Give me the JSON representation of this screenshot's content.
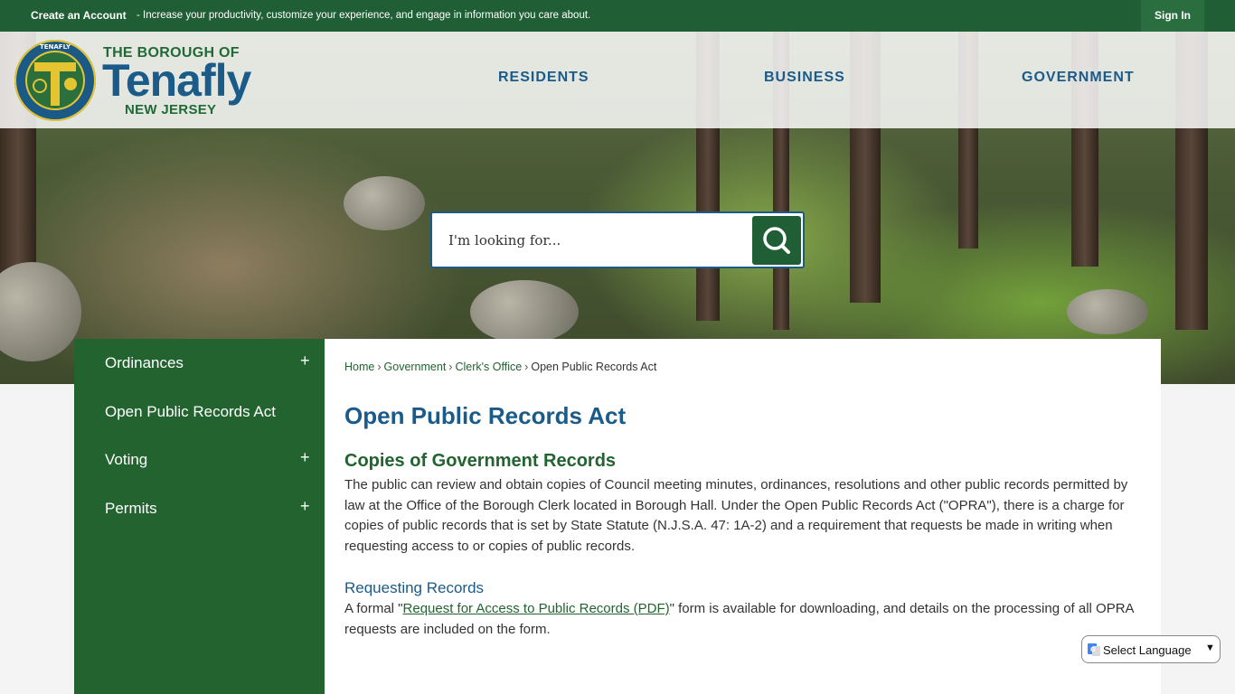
{
  "topbar": {
    "create_account": "Create an Account",
    "tagline": "- Increase your productivity, customize your experience, and engage in information you care about.",
    "sign_in": "Sign In"
  },
  "brand": {
    "line1": "THE BOROUGH OF",
    "line2": "Tenafly",
    "line3": "NEW JERSEY",
    "seal_text": "BOROUGH OF TENAFLY"
  },
  "nav": [
    "RESIDENTS",
    "BUSINESS",
    "GOVERNMENT"
  ],
  "search": {
    "placeholder": "I'm looking for..."
  },
  "sidebar": {
    "items": [
      {
        "label": "Ordinances",
        "expand": "+"
      },
      {
        "label": "Open Public Records Act",
        "expand": ""
      },
      {
        "label": "Voting",
        "expand": "+"
      },
      {
        "label": "Permits",
        "expand": "+"
      }
    ]
  },
  "breadcrumb": {
    "items": [
      "Home",
      "Government",
      "Clerk's Office",
      "Open Public Records Act"
    ],
    "separator": "›"
  },
  "page": {
    "title": "Open Public Records Act",
    "section1_heading": "Copies of Government Records",
    "section1_text": "The public can review and obtain copies of Council meeting minutes, ordinances, resolutions and other public records permitted by law at the Office of the Borough Clerk located in Borough Hall. Under the Open Public Records Act (\"OPRA\"), there is a charge for copies of public records that is set by State Statute (N.J.S.A. 47: 1A-2) and a requirement that requests be made in writing when requesting access to or copies of public records.",
    "section2_heading": "Requesting Records",
    "section2_before": "A formal \"",
    "section2_link": "Request for Access to Public Records (PDF)",
    "section2_after": "\" form is available for downloading, and details on the processing of all OPRA requests are included on the form."
  },
  "language": {
    "label": "Select Language"
  },
  "colors": {
    "green": "#22632f",
    "blue": "#1a5b8a",
    "topbar": "#205f35"
  }
}
